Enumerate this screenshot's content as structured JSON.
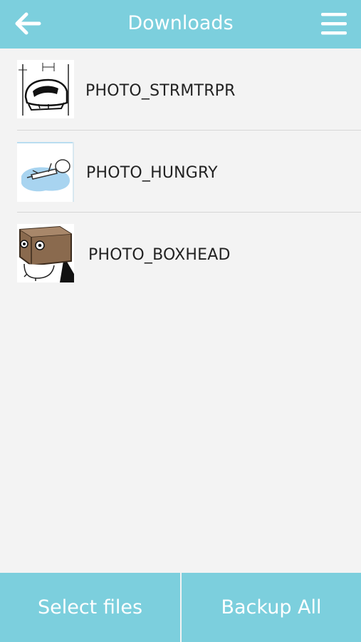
{
  "header": {
    "title": "Downloads",
    "back_icon": "arrow-left-icon",
    "menu_icon": "hamburger-menu-icon"
  },
  "downloads": [
    {
      "label": "PHOTO_STRMTRPR",
      "thumbnail": "stormtrooper-helmet-image"
    },
    {
      "label": "PHOTO_HUNGRY",
      "thumbnail": "hungry-figure-image"
    },
    {
      "label": "PHOTO_BOXHEAD",
      "thumbnail": "boxhead-figure-image"
    }
  ],
  "footer": {
    "select_label": "Select files",
    "backup_label": "Backup All"
  },
  "colors": {
    "accent": "#7ccfdd",
    "background": "#f3f3f3",
    "divider": "#d6d6d6"
  }
}
